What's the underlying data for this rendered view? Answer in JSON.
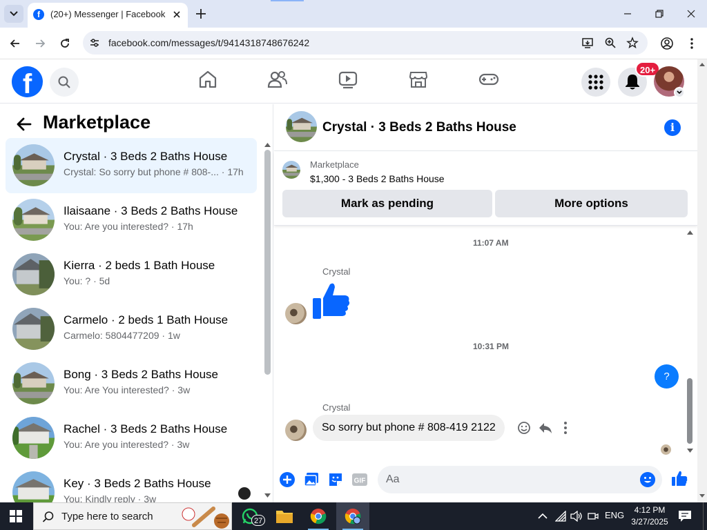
{
  "browser": {
    "tab_title": "(20+) Messenger | Facebook",
    "url": "facebook.com/messages/t/9414318748676242"
  },
  "fb_header": {
    "notifications_badge": "20+"
  },
  "left_panel": {
    "title": "Marketplace",
    "conversations": [
      {
        "name": "Crystal · 3 Beds 2 Baths House",
        "preview": "Crystal: So sorry but phone # 808-... · 17h",
        "active": true
      },
      {
        "name": "Ilaisaane · 3 Beds 2 Baths House",
        "preview": "You: Are you interested? · 17h"
      },
      {
        "name": "Kierra · 2 beds 1 Bath House",
        "preview": "You: ? · 5d"
      },
      {
        "name": "Carmelo · 2 beds 1 Bath House",
        "preview": "Carmelo: 5804477209 · 1w"
      },
      {
        "name": "Bong · 3 Beds 2 Baths House",
        "preview": "You: Are You interested? · 3w"
      },
      {
        "name": "Rachel · 3 Beds 2 Baths House",
        "preview": "You: Are you interested? · 3w"
      },
      {
        "name": "Key · 3 Beds 2 Baths House",
        "preview": "You: Kindly reply · 3w"
      }
    ]
  },
  "chat": {
    "title": "Crystal · 3 Beds 2 Baths House",
    "listing_label": "Marketplace",
    "listing_price": "$1,300 - 3 Beds 2 Baths House",
    "mark_pending_label": "Mark as pending",
    "more_options_label": "More options",
    "messages": {
      "time1": "11:07 AM",
      "sender1": "Crystal",
      "time2": "10:31 PM",
      "outgoing": "?",
      "sender2": "Crystal",
      "incoming_text": "So sorry but phone # 808-419 2122"
    },
    "composer_placeholder": "Aa"
  },
  "taskbar": {
    "search_placeholder": "Type here to search",
    "whatsapp_badge": "27",
    "lang": "ENG",
    "time": "4:12 PM",
    "date": "3/27/2025"
  },
  "colors": {
    "fb_blue": "#0866ff",
    "messenger_blue": "#0a7cff",
    "active_row": "#ebf5ff",
    "badge_red": "#e41e3f"
  }
}
